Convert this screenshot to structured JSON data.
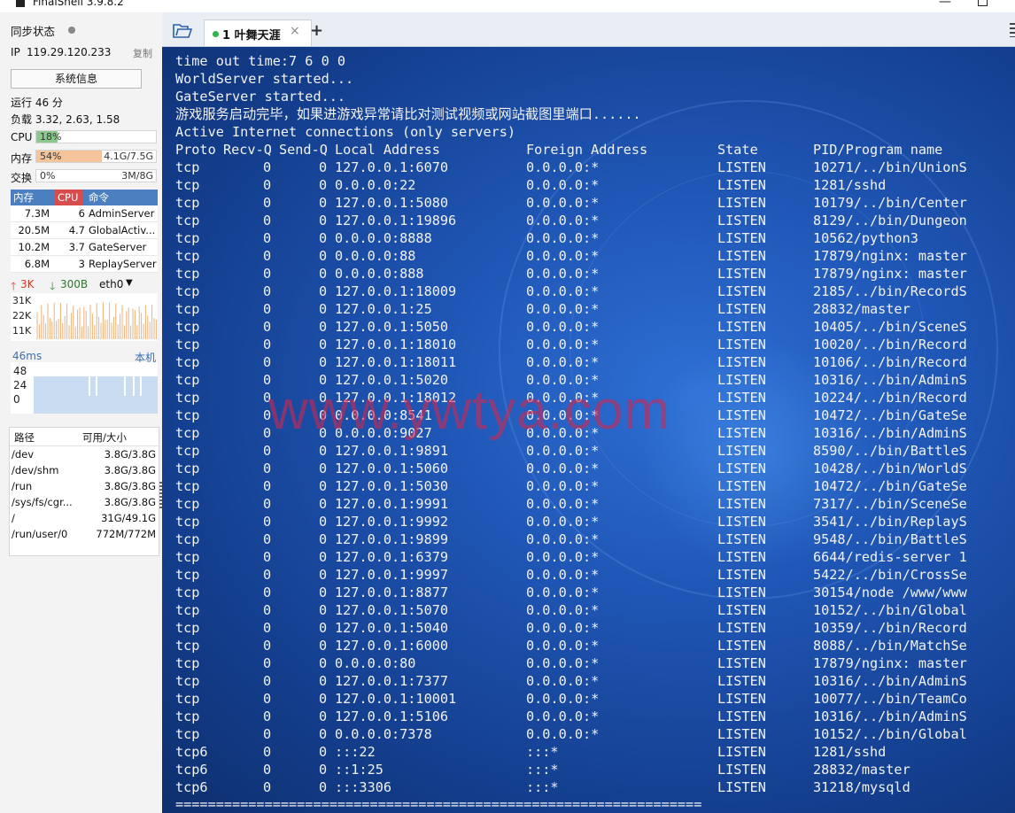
{
  "window": {
    "title": "FinalShell 3.9.8.2"
  },
  "sidebar": {
    "sync_label": "同步状态",
    "ip_label": "IP",
    "ip": "119.29.120.233",
    "copy_label": "复制",
    "sysinfo_button": "系统信息",
    "uptime": "运行 46 分",
    "load": "负载 3.32, 2.63, 1.58",
    "cpu": {
      "label": "CPU",
      "text": "18%",
      "value": 18,
      "color": "#8bc88b"
    },
    "mem": {
      "label": "内存",
      "text": "54%",
      "value": 54,
      "detail": "4.1G/7.5G",
      "color": "#f6c49a"
    },
    "swap": {
      "label": "交换",
      "text": "0%",
      "value": 0,
      "detail": "3M/8G"
    },
    "proc_headers": {
      "mem": "内存",
      "cpu": "CPU",
      "cmd": "命令"
    },
    "processes": [
      {
        "mem": "7.3M",
        "cpu": "6",
        "cmd": "AdminServer"
      },
      {
        "mem": "20.5M",
        "cpu": "4.7",
        "cmd": "GlobalActiv..."
      },
      {
        "mem": "10.2M",
        "cpu": "3.7",
        "cmd": "GateServer"
      },
      {
        "mem": "6.8M",
        "cpu": "3",
        "cmd": "ReplayServer"
      }
    ],
    "net": {
      "up": "3K",
      "down": "300B",
      "iface": "eth0",
      "ticks": [
        "31K",
        "22K",
        "11K"
      ]
    },
    "ping": {
      "latency": "46ms",
      "target": "本机",
      "ticks": [
        "48",
        "24",
        "0"
      ]
    },
    "disk_headers": {
      "path": "路径",
      "size": "可用/大小"
    },
    "disks": [
      {
        "path": "/dev",
        "size": "3.8G/3.8G"
      },
      {
        "path": "/dev/shm",
        "size": "3.8G/3.8G"
      },
      {
        "path": "/run",
        "size": "3.8G/3.8G"
      },
      {
        "path": "/sys/fs/cgr...",
        "size": "3.8G/3.8G"
      },
      {
        "path": "/",
        "size": "31G/49.1G"
      },
      {
        "path": "/run/user/0",
        "size": "772M/772M"
      }
    ]
  },
  "tabs": [
    {
      "label": "1 叶舞天涯"
    }
  ],
  "terminal": {
    "intro": [
      "time out time:7 6 0 0",
      "WorldServer started...",
      "GateServer started...",
      "游戏服务启动完毕，如果进游戏异常请比对测试视频或网站截图里端口......",
      "Active Internet connections (only servers)"
    ],
    "header": {
      "proto": "Proto",
      "recvq": "Recv-Q",
      "sendq": "Send-Q",
      "local": "Local Address",
      "foreign": "Foreign Address",
      "state": "State",
      "pid": "PID/Program name"
    },
    "rows": [
      [
        "tcp",
        "0",
        "0",
        "127.0.0.1:6070",
        "0.0.0.0:*",
        "LISTEN",
        "10271/../bin/UnionS"
      ],
      [
        "tcp",
        "0",
        "0",
        "0.0.0.0:22",
        "0.0.0.0:*",
        "LISTEN",
        "1281/sshd"
      ],
      [
        "tcp",
        "0",
        "0",
        "127.0.0.1:5080",
        "0.0.0.0:*",
        "LISTEN",
        "10179/../bin/Center"
      ],
      [
        "tcp",
        "0",
        "0",
        "127.0.0.1:19896",
        "0.0.0.0:*",
        "LISTEN",
        "8129/../bin/Dungeon"
      ],
      [
        "tcp",
        "0",
        "0",
        "0.0.0.0:8888",
        "0.0.0.0:*",
        "LISTEN",
        "10562/python3"
      ],
      [
        "tcp",
        "0",
        "0",
        "0.0.0.0:88",
        "0.0.0.0:*",
        "LISTEN",
        "17879/nginx: master"
      ],
      [
        "tcp",
        "0",
        "0",
        "0.0.0.0:888",
        "0.0.0.0:*",
        "LISTEN",
        "17879/nginx: master"
      ],
      [
        "tcp",
        "0",
        "0",
        "127.0.0.1:18009",
        "0.0.0.0:*",
        "LISTEN",
        "2185/../bin/RecordS"
      ],
      [
        "tcp",
        "0",
        "0",
        "127.0.0.1:25",
        "0.0.0.0:*",
        "LISTEN",
        "28832/master"
      ],
      [
        "tcp",
        "0",
        "0",
        "127.0.0.1:5050",
        "0.0.0.0:*",
        "LISTEN",
        "10405/../bin/SceneS"
      ],
      [
        "tcp",
        "0",
        "0",
        "127.0.0.1:18010",
        "0.0.0.0:*",
        "LISTEN",
        "10020/../bin/Record"
      ],
      [
        "tcp",
        "0",
        "0",
        "127.0.0.1:18011",
        "0.0.0.0:*",
        "LISTEN",
        "10106/../bin/Record"
      ],
      [
        "tcp",
        "0",
        "0",
        "127.0.0.1:5020",
        "0.0.0.0:*",
        "LISTEN",
        "10316/../bin/AdminS"
      ],
      [
        "tcp",
        "0",
        "0",
        "127.0.0.1:18012",
        "0.0.0.0:*",
        "LISTEN",
        "10224/../bin/Record"
      ],
      [
        "tcp",
        "0",
        "0",
        "0.0.0.0:8541",
        "0.0.0.0:*",
        "LISTEN",
        "10472/../bin/GateSe"
      ],
      [
        "tcp",
        "0",
        "0",
        "0.0.0.0:9027",
        "0.0.0.0:*",
        "LISTEN",
        "10316/../bin/AdminS"
      ],
      [
        "tcp",
        "0",
        "0",
        "127.0.0.1:9891",
        "0.0.0.0:*",
        "LISTEN",
        "8590/../bin/BattleS"
      ],
      [
        "tcp",
        "0",
        "0",
        "127.0.0.1:5060",
        "0.0.0.0:*",
        "LISTEN",
        "10428/../bin/WorldS"
      ],
      [
        "tcp",
        "0",
        "0",
        "127.0.0.1:5030",
        "0.0.0.0:*",
        "LISTEN",
        "10472/../bin/GateSe"
      ],
      [
        "tcp",
        "0",
        "0",
        "127.0.0.1:9991",
        "0.0.0.0:*",
        "LISTEN",
        "7317/../bin/SceneSe"
      ],
      [
        "tcp",
        "0",
        "0",
        "127.0.0.1:9992",
        "0.0.0.0:*",
        "LISTEN",
        "3541/../bin/ReplayS"
      ],
      [
        "tcp",
        "0",
        "0",
        "127.0.0.1:9899",
        "0.0.0.0:*",
        "LISTEN",
        "9548/../bin/BattleS"
      ],
      [
        "tcp",
        "0",
        "0",
        "127.0.0.1:6379",
        "0.0.0.0:*",
        "LISTEN",
        "6644/redis-server 1"
      ],
      [
        "tcp",
        "0",
        "0",
        "127.0.0.1:9997",
        "0.0.0.0:*",
        "LISTEN",
        "5422/../bin/CrossSe"
      ],
      [
        "tcp",
        "0",
        "0",
        "127.0.0.1:8877",
        "0.0.0.0:*",
        "LISTEN",
        "30154/node /www/www"
      ],
      [
        "tcp",
        "0",
        "0",
        "127.0.0.1:5070",
        "0.0.0.0:*",
        "LISTEN",
        "10152/../bin/Global"
      ],
      [
        "tcp",
        "0",
        "0",
        "127.0.0.1:5040",
        "0.0.0.0:*",
        "LISTEN",
        "10359/../bin/Record"
      ],
      [
        "tcp",
        "0",
        "0",
        "127.0.0.1:6000",
        "0.0.0.0:*",
        "LISTEN",
        "8088/../bin/MatchSe"
      ],
      [
        "tcp",
        "0",
        "0",
        "0.0.0.0:80",
        "0.0.0.0:*",
        "LISTEN",
        "17879/nginx: master"
      ],
      [
        "tcp",
        "0",
        "0",
        "127.0.0.1:7377",
        "0.0.0.0:*",
        "LISTEN",
        "10316/../bin/AdminS"
      ],
      [
        "tcp",
        "0",
        "0",
        "127.0.0.1:10001",
        "0.0.0.0:*",
        "LISTEN",
        "10077/../bin/TeamCo"
      ],
      [
        "tcp",
        "0",
        "0",
        "127.0.0.1:5106",
        "0.0.0.0:*",
        "LISTEN",
        "10316/../bin/AdminS"
      ],
      [
        "tcp",
        "0",
        "0",
        "0.0.0.0:7378",
        "0.0.0.0:*",
        "LISTEN",
        "10152/../bin/Global"
      ],
      [
        "tcp6",
        "0",
        "0",
        ":::22",
        ":::*",
        "LISTEN",
        "1281/sshd"
      ],
      [
        "tcp6",
        "0",
        "0",
        "::1:25",
        ":::*",
        "LISTEN",
        "28832/master"
      ],
      [
        "tcp6",
        "0",
        "0",
        ":::3306",
        ":::*",
        "LISTEN",
        "31218/mysqld"
      ]
    ],
    "separator": "=================================================================",
    "watermark": "www.ywtya.com"
  },
  "colors": {
    "accent": "#4b7fbf",
    "cpu_header": "#d94c4c",
    "terminal_bg": "#1f56b5"
  }
}
